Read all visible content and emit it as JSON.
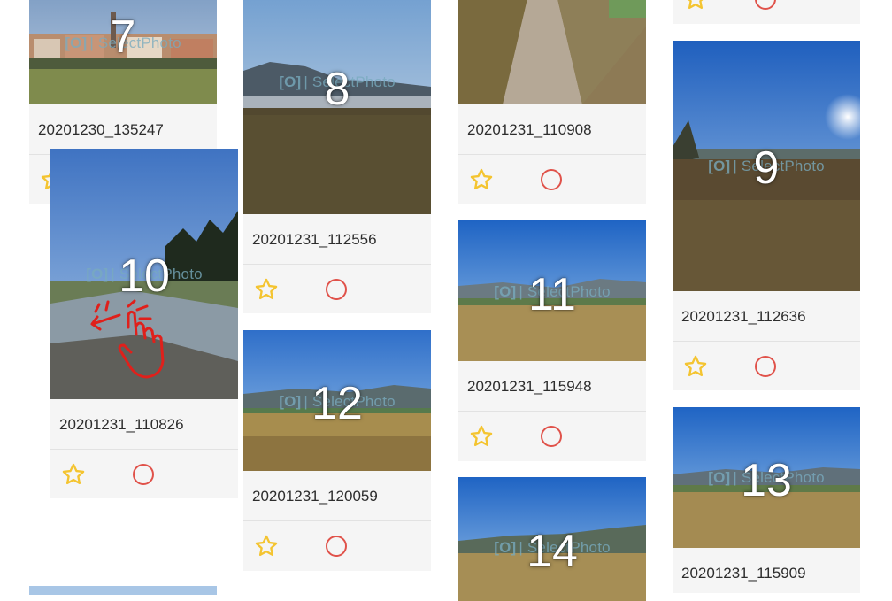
{
  "accent": {
    "star": "#f4c430",
    "select_ring": "#e0524a"
  },
  "watermark": {
    "icon": "[O]",
    "text": "| SelectPhoto"
  },
  "photos": [
    {
      "num": "7",
      "name": "20201230_135247",
      "icon_star": "star-outline-icon",
      "icon_select": "select-circle-icon"
    },
    {
      "num": "8",
      "name": "20201231_112556"
    },
    {
      "num": "9",
      "name": "20201231_112636"
    },
    {
      "num": "10",
      "name": "20201231_110826"
    },
    {
      "num": "11",
      "name": "20201231_115948"
    },
    {
      "num": "12",
      "name": "20201231_120059"
    },
    {
      "num": "13",
      "name": "20201231_115909"
    },
    {
      "num": "14",
      "name": ""
    },
    {
      "num": "",
      "name": "20201231_110908"
    }
  ]
}
